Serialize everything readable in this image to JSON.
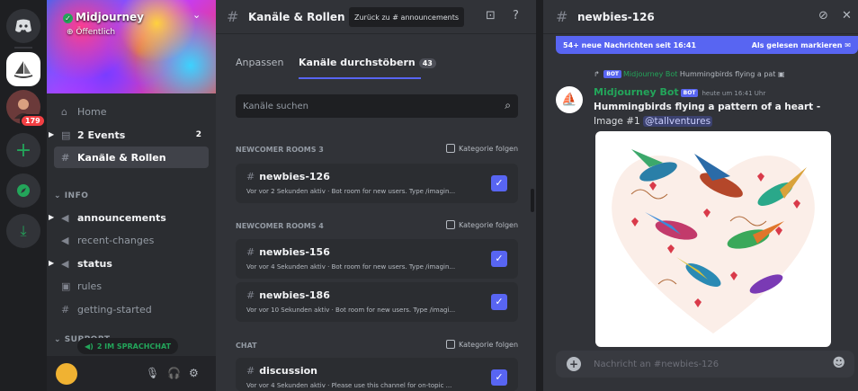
{
  "colors": {
    "accent": "#5865f2",
    "green": "#23a55a",
    "red": "#f23f43"
  },
  "rail": {
    "badge": "179",
    "icons": [
      "discord-icon",
      "midjourney-server-icon",
      "user-server-icon",
      "add-server-icon",
      "explore-icon",
      "download-icon"
    ]
  },
  "server": {
    "name": "Midjourney",
    "visibility": "Öffentlich"
  },
  "sidebar": {
    "items": [
      {
        "label": "Home"
      },
      {
        "label": "2 Events",
        "count": "2"
      },
      {
        "label": "Kanäle & Rollen"
      }
    ],
    "category_info": "INFO",
    "channels": [
      {
        "label": "announcements"
      },
      {
        "label": "recent-changes"
      },
      {
        "label": "status"
      },
      {
        "label": "rules"
      },
      {
        "label": "getting-started"
      }
    ],
    "category_support": "SUPPORT",
    "voice_pill": "2 IM SPRACHCHAT"
  },
  "middle": {
    "title": "Kanäle & Rollen",
    "back_button": "Zurück zu # announcements",
    "tabs": {
      "customize": "Anpassen",
      "browse": "Kanäle durchstöbern",
      "browse_count": "43"
    },
    "search_placeholder": "Kanäle suchen",
    "follow_label": "Kategorie folgen",
    "sections": [
      {
        "title": "NEWCOMER ROOMS 3",
        "cards": [
          {
            "name": "newbies-126",
            "activity": "Vor vor 2 Sekunden aktiv",
            "desc": "Bot room for new users. Type /imagin..."
          }
        ]
      },
      {
        "title": "NEWCOMER ROOMS 4",
        "cards": [
          {
            "name": "newbies-156",
            "activity": "Vor vor 4 Sekunden aktiv",
            "desc": "Bot room for new users. Type /imagin..."
          },
          {
            "name": "newbies-186",
            "activity": "Vor vor 10 Sekunden aktiv",
            "desc": "Bot room for new users. Type /imagi..."
          }
        ]
      },
      {
        "title": "CHAT",
        "cards": [
          {
            "name": "discussion",
            "activity": "Vor vor 4 Sekunden aktiv",
            "desc": "Please use this channel for on-topic ..."
          }
        ]
      }
    ]
  },
  "chat": {
    "title": "newbies-126",
    "new_messages": "54+ neue Nachrichten seit 16:41",
    "mark_read": "Als gelesen markieren",
    "reply_author": "Midjourney Bot",
    "reply_text": "Hummingbirds flying a pat",
    "bot_tag": "BOT",
    "author": "Midjourney Bot",
    "time": "heute um 16:41 Uhr",
    "message_bold": "Hummingbirds flying a pattern of a heart -",
    "message_prefix": "Image #1 ",
    "mention": "@tallventures",
    "composer_placeholder": "Nachricht an #newbies-126"
  }
}
